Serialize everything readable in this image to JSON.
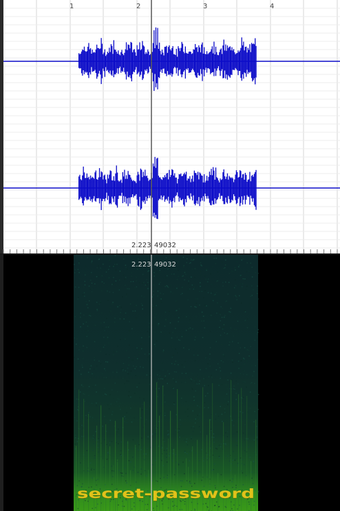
{
  "waveform": {
    "ruler_ticks": [
      "1",
      "2",
      "3",
      "4"
    ],
    "wave_color": "#0c0cc8",
    "cursor_time": "2.223",
    "cursor_sample": "49032"
  },
  "spectrogram": {
    "cursor_time": "2.223",
    "cursor_sample": "49032",
    "hidden_text": "secret-password",
    "text_color": "#e0c21a"
  }
}
